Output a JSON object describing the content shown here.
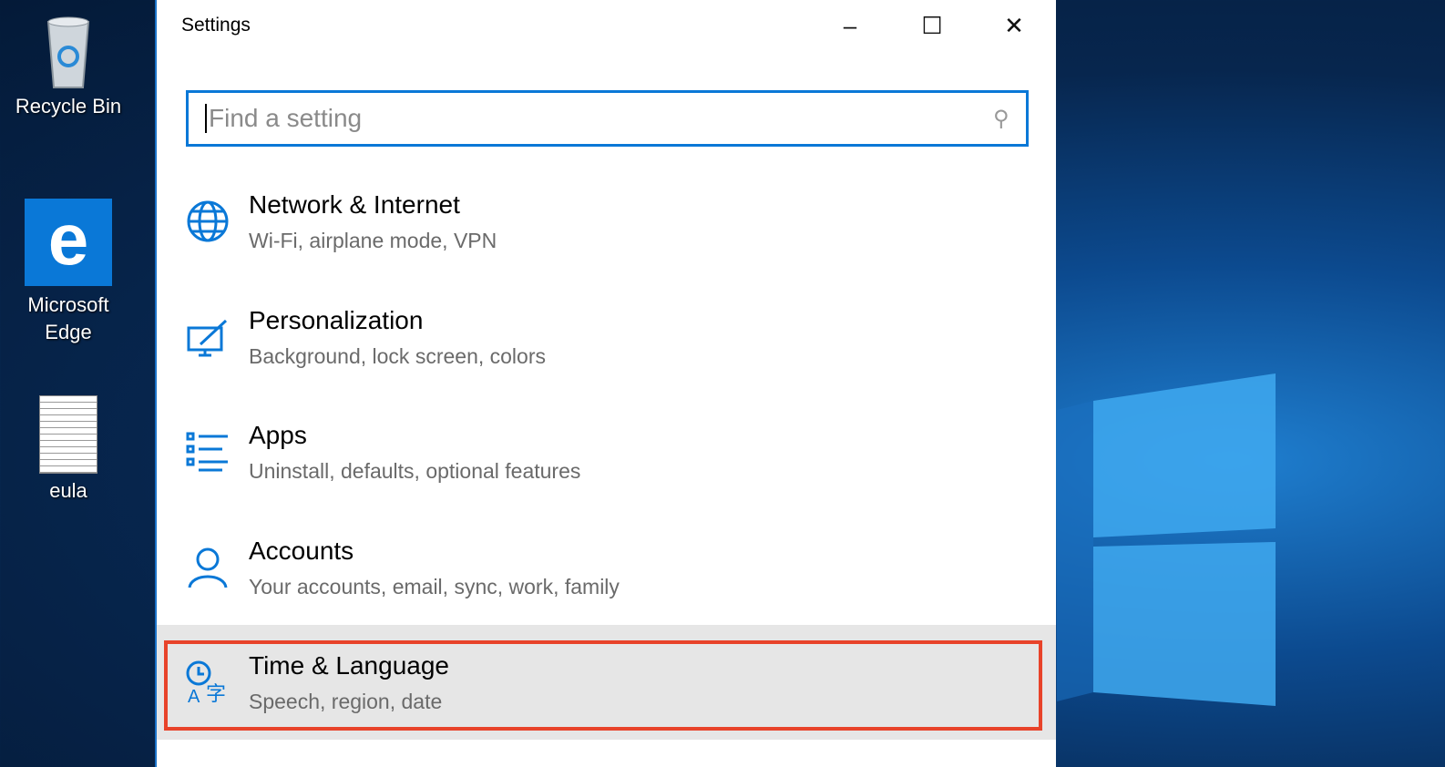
{
  "desktop": {
    "icons": [
      {
        "label": "Recycle Bin",
        "icon": "recycle-bin-icon"
      },
      {
        "label": "Microsoft Edge",
        "icon": "edge-icon"
      },
      {
        "label": "eula",
        "icon": "document-icon"
      }
    ]
  },
  "window": {
    "title": "Settings",
    "minimize": "–",
    "maximize": "☐",
    "close": "✕"
  },
  "search": {
    "placeholder": "Find a setting",
    "icon": "search-icon"
  },
  "items": [
    {
      "title": "Network & Internet",
      "subtitle": "Wi-Fi, airplane mode, VPN",
      "icon": "globe-icon"
    },
    {
      "title": "Personalization",
      "subtitle": "Background, lock screen, colors",
      "icon": "personalization-icon"
    },
    {
      "title": "Apps",
      "subtitle": "Uninstall, defaults, optional features",
      "icon": "apps-list-icon"
    },
    {
      "title": "Accounts",
      "subtitle": "Your accounts, email, sync, work, family",
      "icon": "person-icon"
    },
    {
      "title": "Time & Language",
      "subtitle": "Speech, region, date",
      "icon": "time-language-icon",
      "highlighted": true
    }
  ],
  "colors": {
    "accent": "#0a78d7",
    "highlight": "#e8432a",
    "hover": "#e6e6e6"
  }
}
